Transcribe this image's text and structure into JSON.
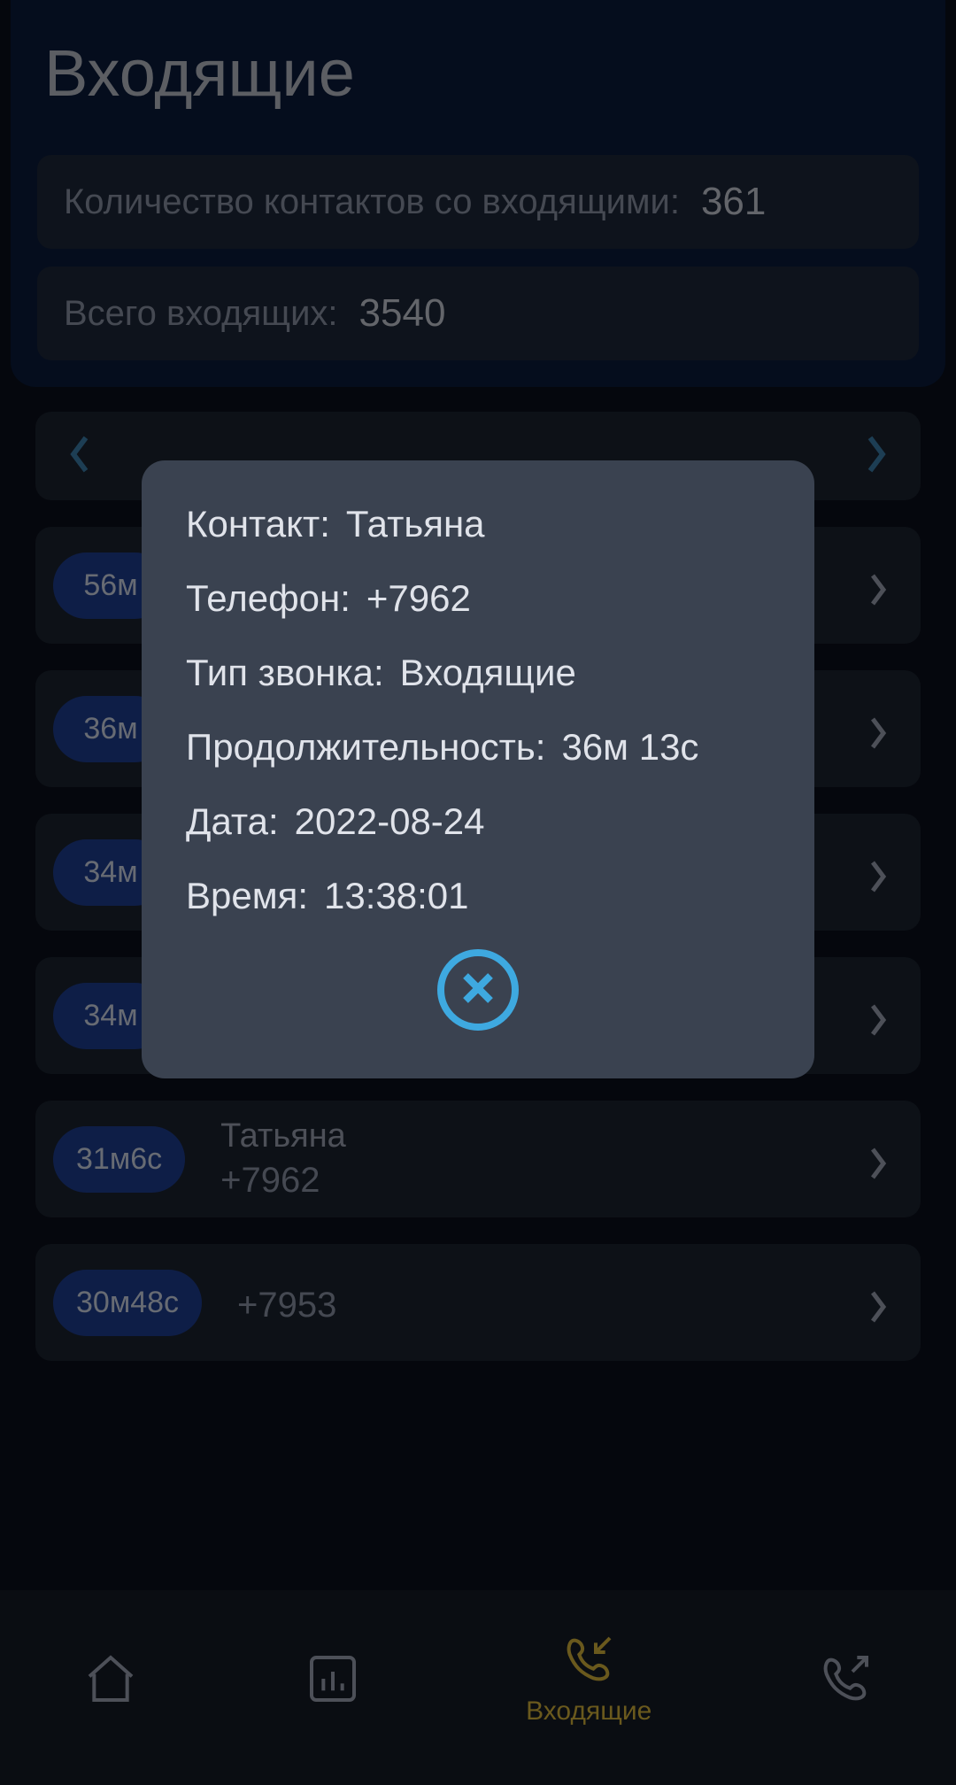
{
  "header": {
    "title": "Входящие"
  },
  "summary": {
    "contacts_label": "Количество контактов со входящими:",
    "contacts_value": "361",
    "total_label": "Всего входящих:",
    "total_value": "3540"
  },
  "calls": [
    {
      "duration": "56м",
      "name": "",
      "number": ""
    },
    {
      "duration": "36м",
      "name": "",
      "number": ""
    },
    {
      "duration": "34м",
      "name": "",
      "number": ""
    },
    {
      "duration": "34м",
      "name": "",
      "number": ""
    },
    {
      "duration": "31м6с",
      "name": "Татьяна",
      "number": "+7962"
    },
    {
      "duration": "30м48с",
      "name": "",
      "number": "+7953"
    }
  ],
  "modal": {
    "contact_label": "Контакт:",
    "contact_value": "Татьяна",
    "phone_label": "Телефон:",
    "phone_value": "+7962",
    "type_label": "Тип звонка:",
    "type_value": "Входящие",
    "duration_label": "Продолжительность:",
    "duration_value": "36м 13с",
    "date_label": "Дата:",
    "date_value": "2022-08-24",
    "time_label": "Время:",
    "time_value": "13:38:01"
  },
  "nav": {
    "incoming_label": "Входящие"
  }
}
